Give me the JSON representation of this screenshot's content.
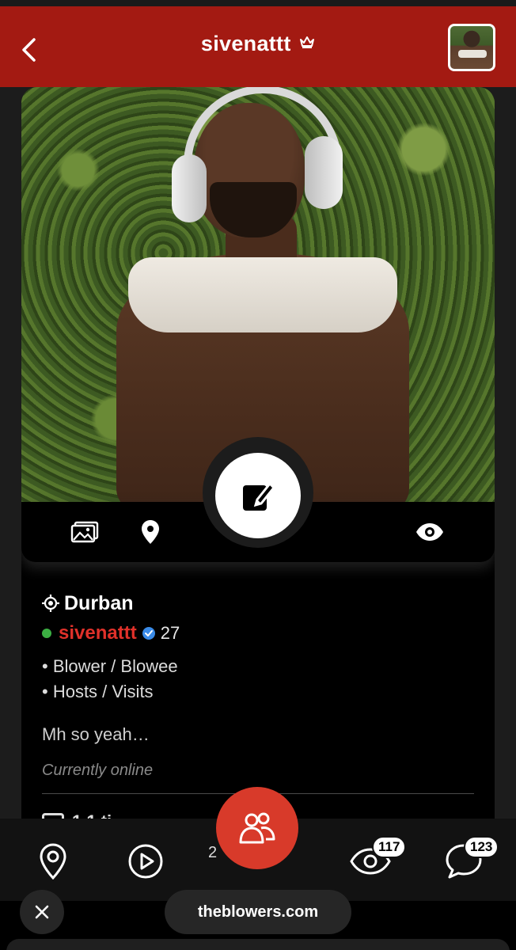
{
  "header": {
    "title": "sivenattt",
    "back_icon": "chevron-left-icon",
    "crown_icon": "crown-icon",
    "avatar": "profile-thumbnail"
  },
  "photo": {
    "alt": "profile-photo"
  },
  "actions": {
    "gallery_icon": "images-icon",
    "location_icon": "map-pin-icon",
    "edit_icon": "edit-icon",
    "views_icon": "eye-icon"
  },
  "profile": {
    "location": "Durban",
    "username": "sivenattt",
    "age": "27",
    "online_color": "#3cb043",
    "tags": [
      "• Blower / Blowee",
      "• Hosts / Visits"
    ],
    "bio": "Mh so yeah…",
    "status": "Currently online",
    "peek_text": "1 1 ti"
  },
  "nav": {
    "items": [
      {
        "icon": "map-pin-icon"
      },
      {
        "icon": "play-circle-icon"
      },
      {
        "icon": "users-icon"
      },
      {
        "icon": "eye-icon",
        "badge": "117"
      },
      {
        "icon": "chat-bubble-icon",
        "badge": "123"
      }
    ],
    "center_label_partial": "2"
  },
  "browser": {
    "url": "theblowers.com",
    "close_icon": "close-icon"
  },
  "colors": {
    "header_red": "#a31a12",
    "accent_red": "#e0312a",
    "nav_center_red": "#d83a2a",
    "verified_blue": "#3a8be8"
  }
}
